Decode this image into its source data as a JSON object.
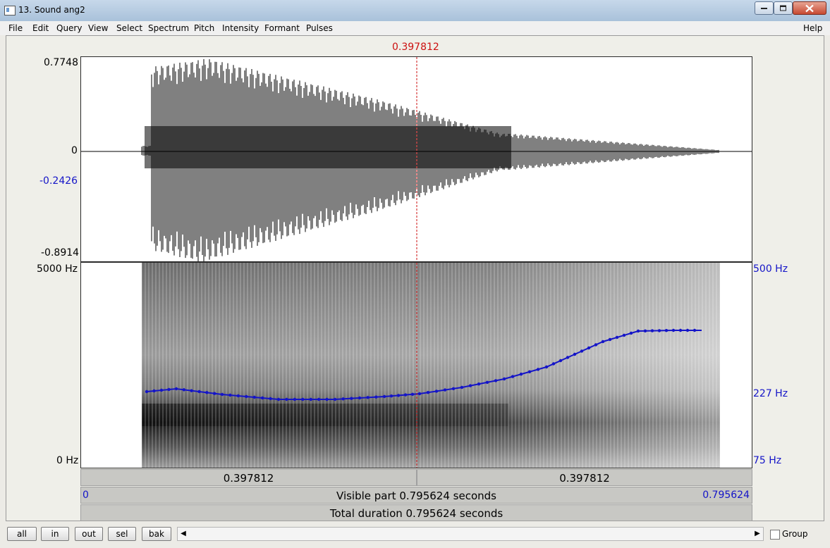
{
  "window": {
    "title": "13. Sound ang2"
  },
  "menu": [
    "File",
    "Edit",
    "Query",
    "View",
    "Select",
    "Spectrum",
    "Pitch",
    "Intensity",
    "Formant",
    "Pulses"
  ],
  "help": "Help",
  "cursor": {
    "time": "0.397812"
  },
  "waveform": {
    "max": "0.7748",
    "zero": "0",
    "cursor_value": "-0.2426",
    "min": "-0.8914"
  },
  "spectrogram": {
    "freq_top": "5000 Hz",
    "freq_bottom": "0 Hz"
  },
  "pitch": {
    "top": "500 Hz",
    "mid": "227 Hz",
    "bottom": "75 Hz"
  },
  "time_bar": {
    "left": "0.397812",
    "right": "0.397812"
  },
  "visible_bar": {
    "start": "0",
    "text": "Visible part 0.795624 seconds",
    "end": "0.795624"
  },
  "total_bar": {
    "text": "Total duration 0.795624 seconds"
  },
  "zoom_buttons": [
    "all",
    "in",
    "out",
    "sel",
    "bak"
  ],
  "group": {
    "label": "Group",
    "checked": false
  },
  "colors": {
    "cursor": "#cc1010",
    "pitch": "#1414c8",
    "axis_blue": "#1414c8"
  }
}
